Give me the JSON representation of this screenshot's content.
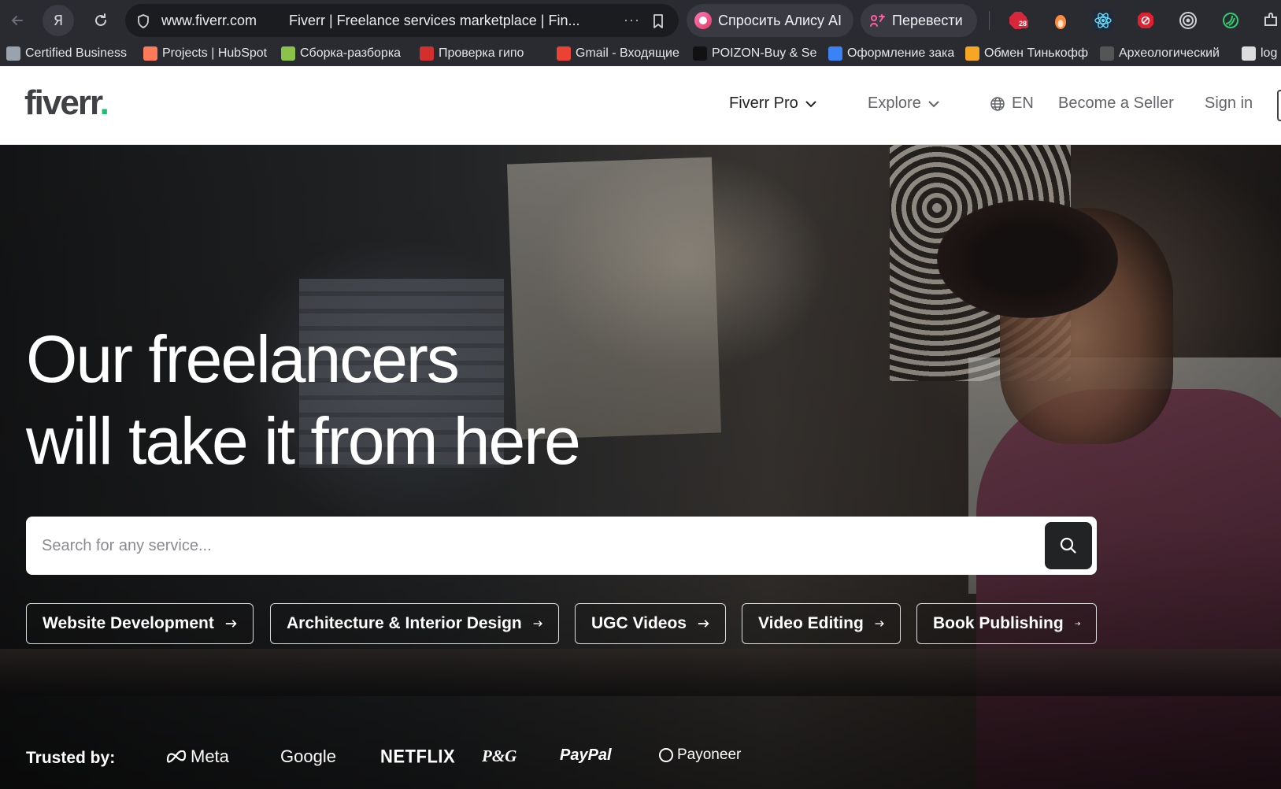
{
  "browser": {
    "url_domain": "www.fiverr.com",
    "tab_title": "Fiverr | Freelance services marketplace | Fin...",
    "yandex_label": "Я",
    "more_label": "···",
    "alice_label": "Спросить Алису AI",
    "translate_label": "Перевести",
    "extension_badge": "28",
    "bookmarks": [
      {
        "label": "Certified Business",
        "color": "#9aa3ad"
      },
      {
        "label": "Projects | HubSpot",
        "color": "#ff7a59"
      },
      {
        "label": "Сборка-разборка",
        "color": "#8bc34a"
      },
      {
        "label": "Проверка гипо",
        "color": "#d32f2f"
      },
      {
        "label": "Gmail - Входящие",
        "color": "#ea4335"
      },
      {
        "label": "POIZON-Buy & Se",
        "color": "#111111"
      },
      {
        "label": "Оформление зака",
        "color": "#3b82f6"
      },
      {
        "label": "Обмен Тинькофф",
        "color": "#f5a623"
      },
      {
        "label": "Археологический",
        "color": "#555555"
      },
      {
        "label": "log",
        "color": "#dddddd"
      }
    ]
  },
  "header": {
    "logo_text": "fiverr",
    "logo_dot": ".",
    "nav": {
      "pro": "Fiverr Pro",
      "explore": "Explore",
      "lang": "EN",
      "seller": "Become a Seller",
      "signin": "Sign in"
    }
  },
  "hero": {
    "title_line1": "Our freelancers",
    "title_line2": "will take it from here",
    "search_placeholder": "Search for any service...",
    "chips": [
      "Website Development",
      "Architecture & Interior Design",
      "UGC Videos",
      "Video Editing",
      "Book Publishing"
    ],
    "trusted_label": "Trusted by:",
    "brands": [
      "Meta",
      "Google",
      "NETFLIX",
      "P&G",
      "PayPal",
      "Payoneer"
    ]
  },
  "colors": {
    "brand_green": "#1dbf73",
    "text_dark": "#404145",
    "search_button": "#222325"
  }
}
